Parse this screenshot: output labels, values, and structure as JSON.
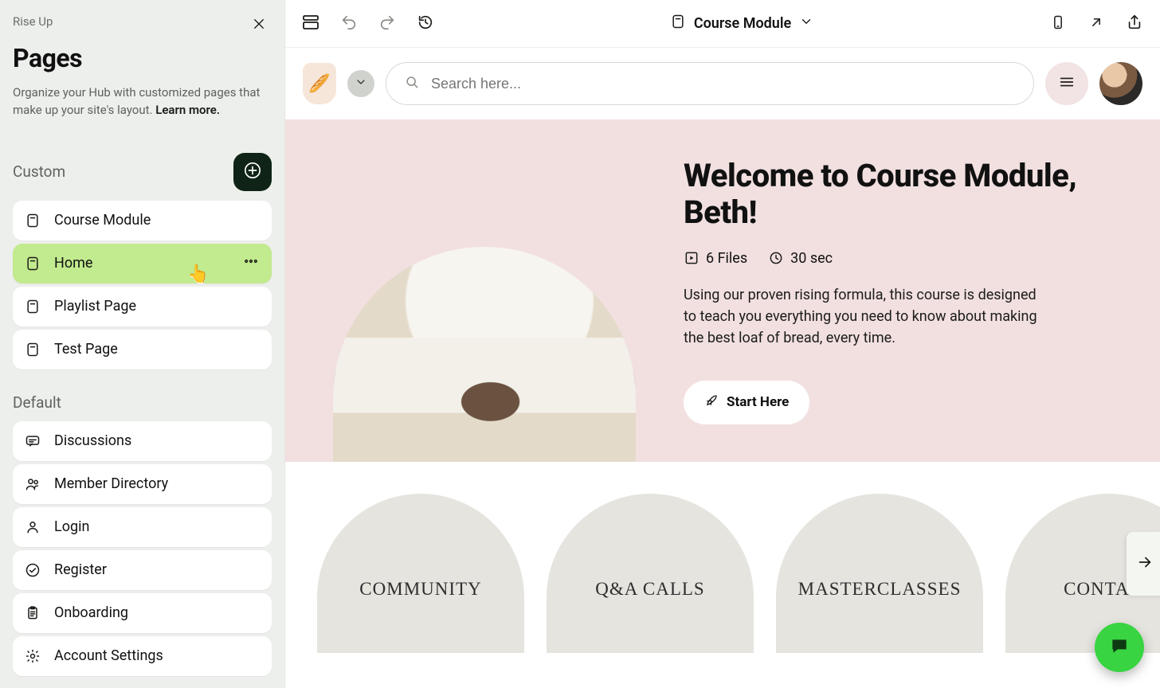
{
  "sidebar": {
    "brand": "Rise Up",
    "title": "Pages",
    "description": "Organize your Hub with customized pages that make up your site's layout. ",
    "learn_more": "Learn more.",
    "custom_label": "Custom",
    "default_label": "Default",
    "custom_items": [
      {
        "label": "Course Module"
      },
      {
        "label": "Home"
      },
      {
        "label": "Playlist Page"
      },
      {
        "label": "Test Page"
      }
    ],
    "default_items": [
      {
        "label": "Discussions"
      },
      {
        "label": "Member Directory"
      },
      {
        "label": "Login"
      },
      {
        "label": "Register"
      },
      {
        "label": "Onboarding"
      },
      {
        "label": "Account Settings"
      }
    ]
  },
  "topbar": {
    "document_label": "Course Module"
  },
  "preview": {
    "search_placeholder": "Search here...",
    "hero_title": "Welcome to Course Module, Beth!",
    "files_label": "6 Files",
    "duration_label": "30 sec",
    "hero_desc": "Using our proven rising formula, this course is designed to teach you everything you need to know about making the best loaf of bread, every time.",
    "cta_label": "Start Here",
    "cards": [
      "COMMUNITY",
      "Q&A CALLS",
      "MASTERCLASSES",
      "CONTACT"
    ]
  }
}
